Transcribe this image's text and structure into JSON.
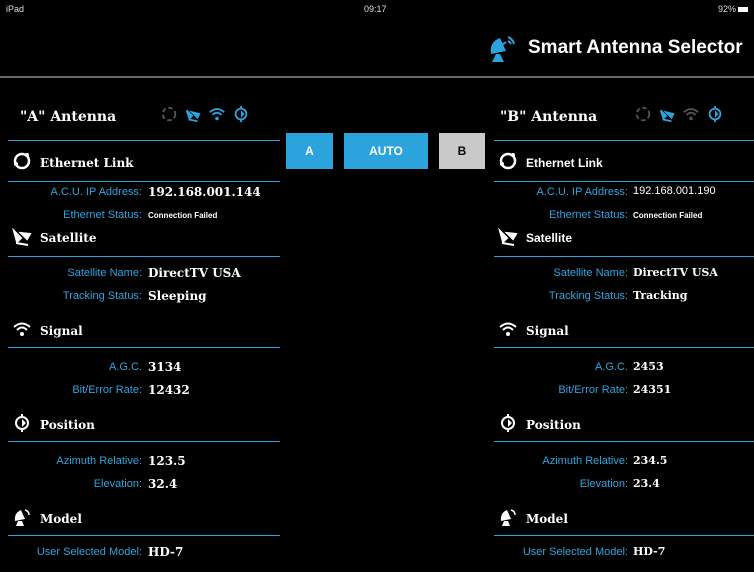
{
  "status": {
    "device": "iPad",
    "time": "09:17",
    "battery": "92%"
  },
  "app": {
    "title": "Smart Antenna Selector"
  },
  "selector": {
    "a": "A",
    "auto": "AUTO",
    "b": "B"
  },
  "panelA": {
    "title": "\"A\" Antenna",
    "ethernet": {
      "title": "Ethernet Link",
      "ip_label": "A.C.U. IP Address:",
      "ip": "192.168.001.144",
      "status_label": "Ethernet Status:",
      "status": "Connection Failed"
    },
    "satellite": {
      "title": "Satellite",
      "name_label": "Satellite Name:",
      "name": "DirectTV USA",
      "tracking_label": "Tracking Status:",
      "tracking": "Sleeping"
    },
    "signal": {
      "title": "Signal",
      "agc_label": "A.G.C.",
      "agc": "3134",
      "ber_label": "Bit/Error Rate:",
      "ber": "12432"
    },
    "position": {
      "title": "Position",
      "az_label": "Azimuth Relative:",
      "az": "123.5",
      "el_label": "Elevation:",
      "el": "32.4"
    },
    "model": {
      "title": "Model",
      "user_label": "User Selected Model:",
      "user": "HD-7"
    }
  },
  "panelB": {
    "title": "\"B\" Antenna",
    "ethernet": {
      "title": "Ethernet Link",
      "ip_label": "A.C.U. IP Address:",
      "ip": "192.168.001.190",
      "status_label": "Ethernet Status:",
      "status": "Connection Failed"
    },
    "satellite": {
      "title": "Satellite",
      "name_label": "Satellite Name:",
      "name": "DirectTV USA",
      "tracking_label": "Tracking Status:",
      "tracking": "Tracking"
    },
    "signal": {
      "title": "Signal",
      "agc_label": "A.G.C.",
      "agc": "2453",
      "ber_label": "Bit/Error Rate:",
      "ber": "24351"
    },
    "position": {
      "title": "Position",
      "az_label": "Azimuth Relative:",
      "az": "234.5",
      "el_label": "Elevation:",
      "el": "23.4"
    },
    "model": {
      "title": "Model",
      "user_label": "User Selected Model:",
      "user": "HD-7"
    }
  },
  "colors": {
    "accent": "#2ba4de",
    "inactive_button": "#c9c9c9",
    "background": "#000000"
  },
  "icons": [
    "ethernet-icon",
    "satellite-icon",
    "signal-icon",
    "position-icon",
    "model-dish-icon"
  ]
}
